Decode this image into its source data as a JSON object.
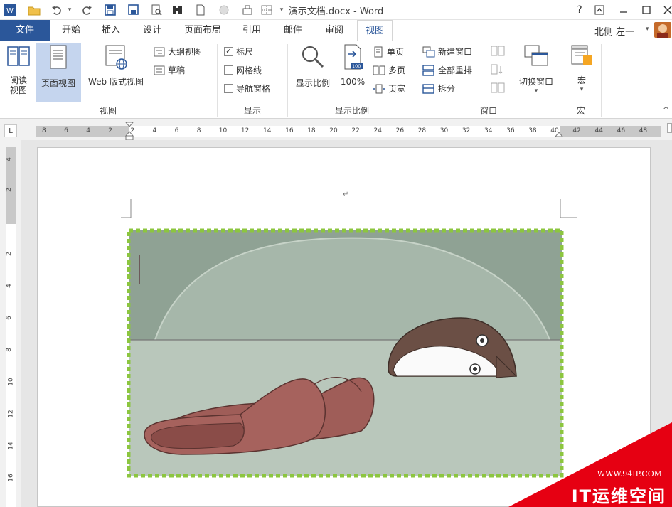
{
  "window": {
    "title": "演示文档.docx - Word",
    "help": "?",
    "restore_icon": "ribbon-display-icon",
    "user": "北侧 左一"
  },
  "quick_access": {
    "icons": [
      "word-logo-icon",
      "open-folder-icon",
      "undo-icon",
      "redo-icon",
      "save-icon",
      "save-as-icon",
      "print-preview-icon",
      "find-icon",
      "new-doc-icon",
      "circle-icon",
      "form-icon",
      "table-icon",
      "customize-icon"
    ]
  },
  "tabs": [
    "文件",
    "开始",
    "插入",
    "设计",
    "页面布局",
    "引用",
    "邮件",
    "审阅",
    "视图"
  ],
  "ribbon": {
    "views": {
      "label": "视图",
      "read_mode": "阅读\n视图",
      "print_layout": "页面视图",
      "web_layout": "Web 版式视图",
      "outline": "大纲视图",
      "draft": "草稿"
    },
    "show": {
      "label": "显示",
      "ruler": "标尺",
      "ruler_checked": true,
      "gridlines": "网格线",
      "gridlines_checked": false,
      "nav_pane": "导航窗格",
      "nav_pane_checked": false
    },
    "zoom": {
      "label": "显示比例",
      "zoom": "显示比例",
      "hundred": "100%",
      "hundred_badge": "100",
      "one_page": "单页",
      "multi_page": "多页",
      "page_width": "页宽"
    },
    "window": {
      "label": "窗口",
      "new_window": "新建窗口",
      "arrange_all": "全部重排",
      "split": "拆分",
      "switch_windows": "切换窗口"
    },
    "macros": {
      "label": "宏",
      "macros": "宏"
    }
  },
  "hruler_ticks": [
    "8",
    "6",
    "4",
    "2",
    "2",
    "4",
    "6",
    "8",
    "10",
    "12",
    "14",
    "16",
    "18",
    "20",
    "22",
    "24",
    "26",
    "28",
    "30",
    "32",
    "34",
    "36",
    "38",
    "40",
    "42",
    "44",
    "46",
    "48"
  ],
  "vruler_ticks": [
    "4",
    "2",
    "2",
    "4",
    "6",
    "8",
    "10",
    "12",
    "14",
    "16"
  ],
  "document": {
    "paragraph_mark": "↵"
  },
  "watermark": {
    "url": "WWW.94IP.COM",
    "brand": "IT运维空间"
  },
  "colors": {
    "accent": "#2b579a",
    "frame": "#8cc63f",
    "watermark": "#e60012"
  }
}
